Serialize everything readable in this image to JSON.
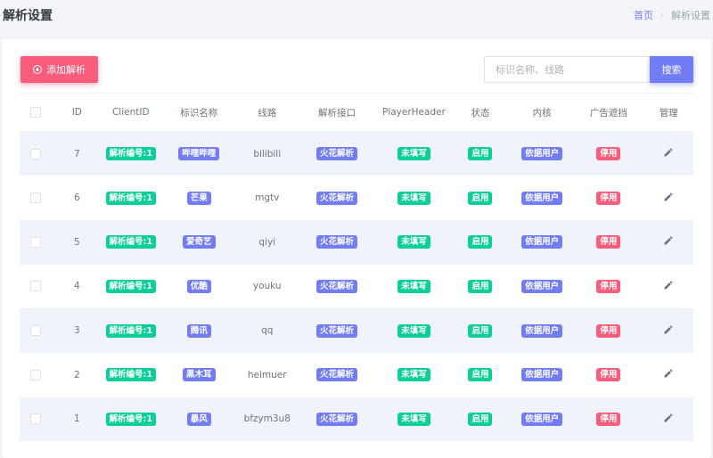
{
  "header": {
    "title": "解析设置",
    "breadcrumb": {
      "home": "首页",
      "separator": "›",
      "current": "解析设置"
    }
  },
  "toolbar": {
    "add_label": "添加解析",
    "search_placeholder": "标识名称、线路",
    "search_button": "搜索"
  },
  "table": {
    "headers": [
      "ID",
      "ClientID",
      "标识名称",
      "线路",
      "解析接口",
      "PlayerHeader",
      "状态",
      "内核",
      "广告遮挡",
      "管理"
    ],
    "rows": [
      {
        "id": "7",
        "client": "解析编号:1",
        "name": "哔哩哔哩",
        "line": "bilibili",
        "api": "火花解析",
        "header": "未填写",
        "status": "启用",
        "kernel": "依据用户",
        "ad": "停用"
      },
      {
        "id": "6",
        "client": "解析编号:1",
        "name": "芒果",
        "line": "mgtv",
        "api": "火花解析",
        "header": "未填写",
        "status": "启用",
        "kernel": "依据用户",
        "ad": "停用"
      },
      {
        "id": "5",
        "client": "解析编号:1",
        "name": "爱奇艺",
        "line": "qiyi",
        "api": "火花解析",
        "header": "未填写",
        "status": "启用",
        "kernel": "依据用户",
        "ad": "停用"
      },
      {
        "id": "4",
        "client": "解析编号:1",
        "name": "优酷",
        "line": "youku",
        "api": "火花解析",
        "header": "未填写",
        "status": "启用",
        "kernel": "依据用户",
        "ad": "停用"
      },
      {
        "id": "3",
        "client": "解析编号:1",
        "name": "腾讯",
        "line": "qq",
        "api": "火花解析",
        "header": "未填写",
        "status": "启用",
        "kernel": "依据用户",
        "ad": "停用"
      },
      {
        "id": "2",
        "client": "解析编号:1",
        "name": "黑木耳",
        "line": "heimuer",
        "api": "火花解析",
        "header": "未填写",
        "status": "启用",
        "kernel": "依据用户",
        "ad": "停用"
      },
      {
        "id": "1",
        "client": "解析编号:1",
        "name": "暴风",
        "line": "bfzym3u8",
        "api": "火花解析",
        "header": "未填写",
        "status": "启用",
        "kernel": "依据用户",
        "ad": "停用"
      }
    ]
  },
  "icons": {
    "add": "plus-circle-icon",
    "edit": "pencil-icon"
  },
  "colors": {
    "primary": "#727cf5",
    "success": "#0acf97",
    "danger": "#fa5c7c",
    "stripe": "#f1f3fa"
  }
}
